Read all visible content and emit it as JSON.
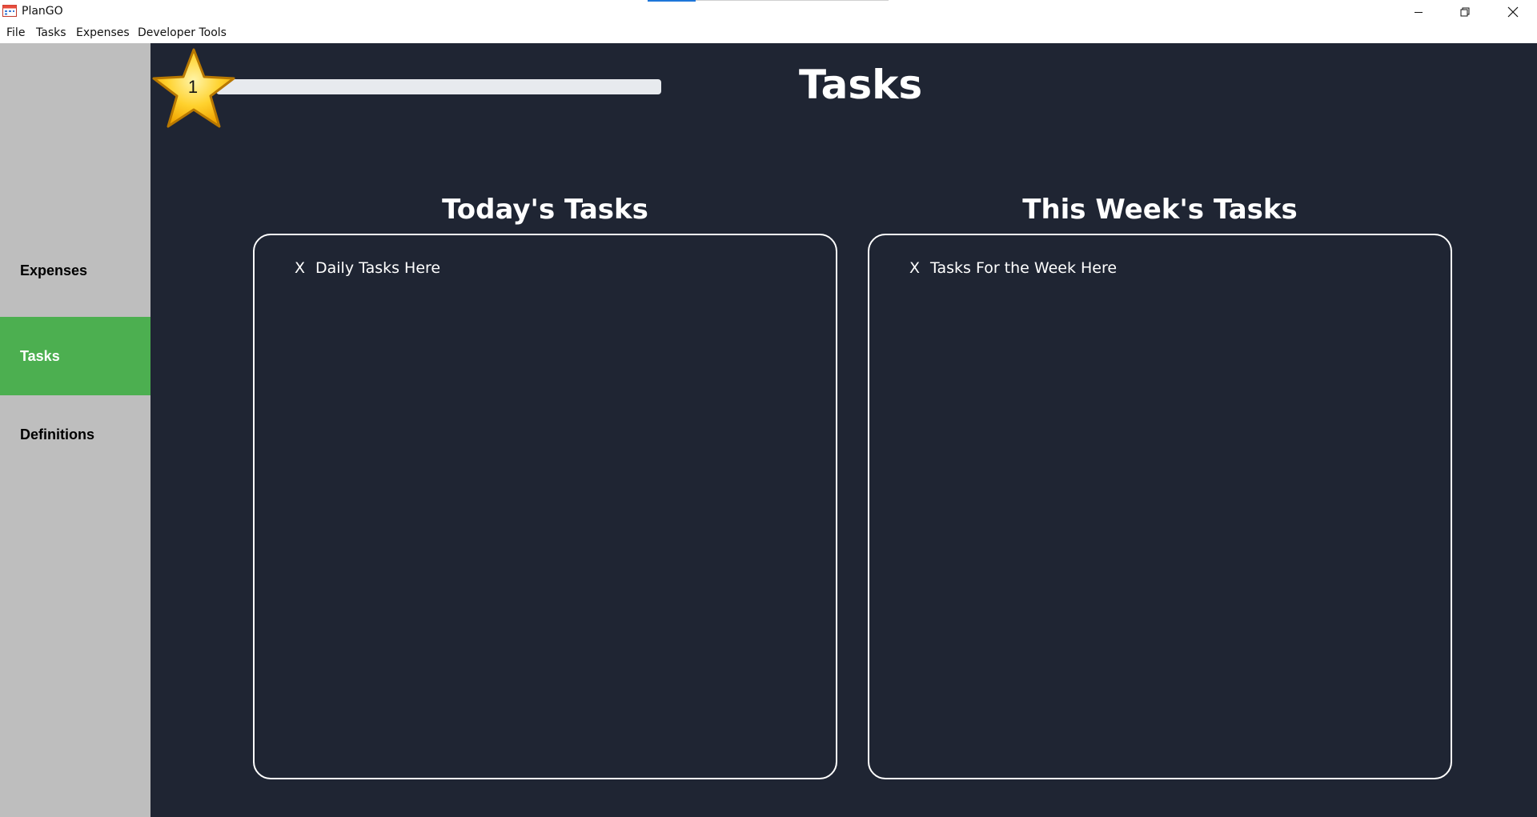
{
  "window": {
    "title": "PlanGO",
    "icon": "calendar-app-icon",
    "controls": [
      "minimize-icon",
      "restore-icon",
      "close-icon"
    ]
  },
  "menu": {
    "items": [
      "File",
      "Tasks",
      "Expenses",
      "Developer Tools"
    ]
  },
  "sidebar": {
    "items": [
      {
        "label": "Expenses",
        "active": false
      },
      {
        "label": "Tasks",
        "active": true
      },
      {
        "label": "Definitions",
        "active": false
      }
    ],
    "active_color": "#4caf50"
  },
  "level": {
    "number": "1",
    "icon": "star-icon",
    "progress": 0
  },
  "page": {
    "title": "Tasks"
  },
  "today": {
    "heading": "Today's Tasks",
    "tasks": [
      {
        "mark": "X",
        "text": "Daily Tasks Here"
      }
    ]
  },
  "week": {
    "heading": "This Week's Tasks",
    "tasks": [
      {
        "mark": "X",
        "text": "Tasks For the Week Here"
      }
    ]
  },
  "colors": {
    "main_bg": "#1f2533",
    "sidebar_bg": "#bebebe",
    "accent": "#4caf50"
  }
}
